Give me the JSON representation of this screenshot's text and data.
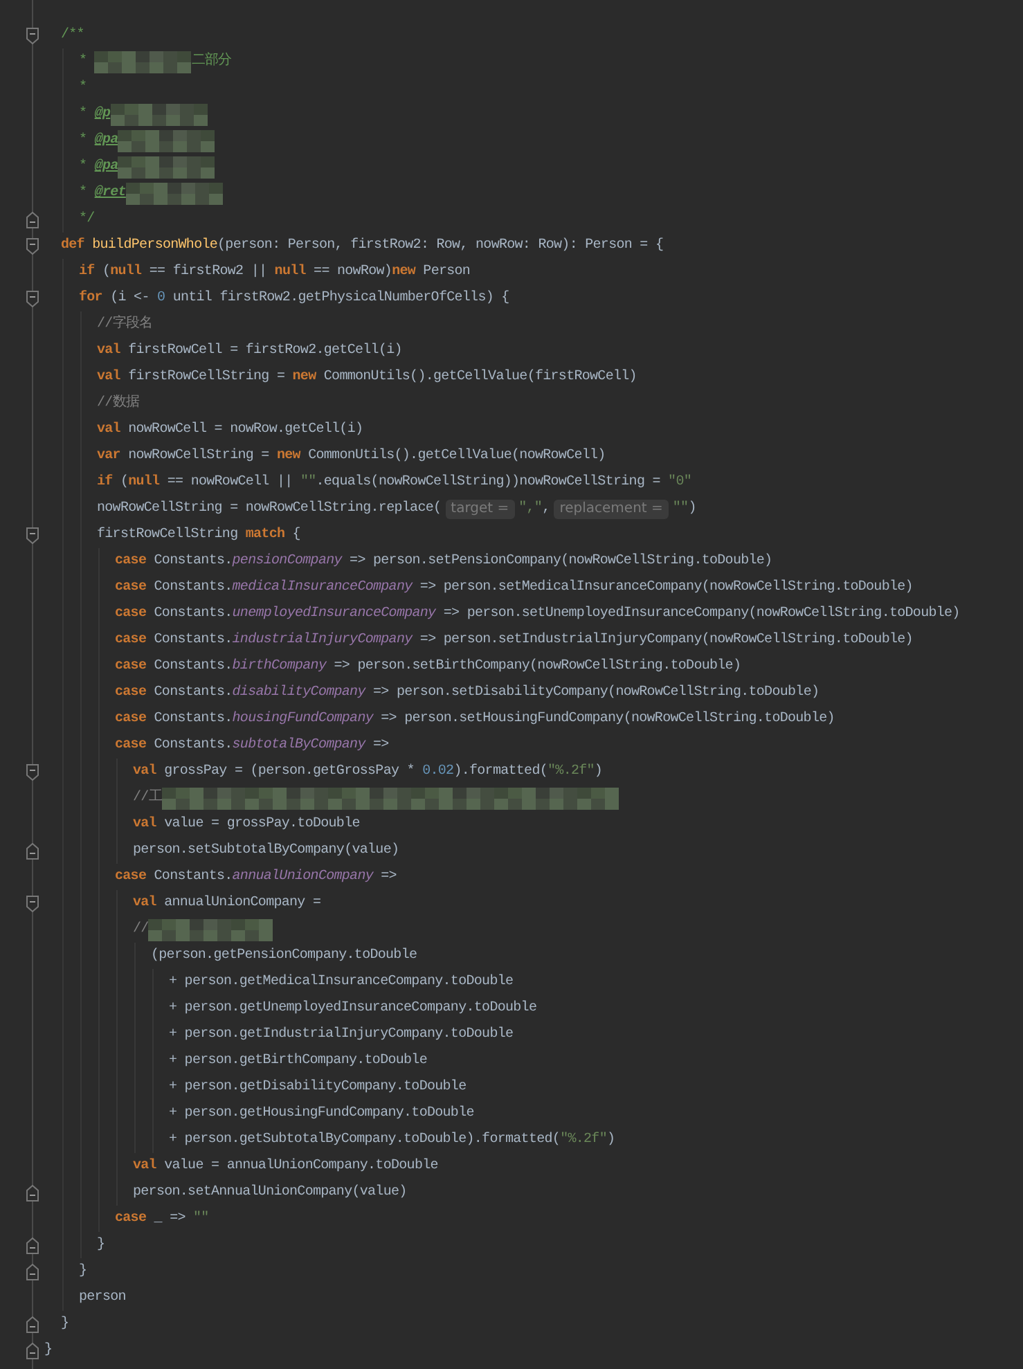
{
  "lines": [
    {
      "kind": "foldstart",
      "tokens": [
        {
          "kind": "doc",
          "text": "/**"
        }
      ],
      "children": [
        {
          "tokens": [
            {
              "kind": "doc",
              "text": "* "
            },
            {
              "kind": "redacted"
            },
            {
              "kind": "doc",
              "text": "二部分"
            }
          ]
        },
        {
          "tokens": [
            {
              "kind": "doc",
              "text": "*"
            }
          ]
        },
        {
          "tokens": [
            {
              "kind": "doc",
              "text": "* "
            },
            {
              "kind": "doctag",
              "text": "@p"
            },
            {
              "kind": "redacted"
            }
          ]
        },
        {
          "tokens": [
            {
              "kind": "doc",
              "text": "* "
            },
            {
              "kind": "doctag",
              "text": "@pa"
            },
            {
              "kind": "redacted"
            }
          ]
        },
        {
          "tokens": [
            {
              "kind": "doc",
              "text": "* "
            },
            {
              "kind": "doctag",
              "text": "@pa"
            },
            {
              "kind": "redacted"
            }
          ]
        },
        {
          "tokens": [
            {
              "kind": "doc",
              "text": "* "
            },
            {
              "kind": "doctag",
              "text": "@ret"
            },
            {
              "kind": "redacted"
            }
          ]
        },
        {
          "kind": "foldend",
          "tokens": [
            {
              "kind": "doc",
              "text": "*/"
            }
          ]
        }
      ]
    },
    {
      "kind": "foldstart",
      "tokens": [
        {
          "kind": "keyword",
          "text": "def "
        },
        {
          "kind": "function",
          "text": "buildPersonWhole"
        },
        {
          "kind": "plain",
          "text": "(person: Person, firstRow2: Row, nowRow: Row): Person = {"
        }
      ],
      "children": [
        {
          "tokens": [
            {
              "kind": "keyword",
              "text": "if "
            },
            {
              "kind": "plain",
              "text": "("
            },
            {
              "kind": "keyword",
              "text": "null"
            },
            {
              "kind": "plain",
              "text": " == firstRow2 || "
            },
            {
              "kind": "keyword",
              "text": "null"
            },
            {
              "kind": "plain",
              "text": " == nowRow)"
            },
            {
              "kind": "keyword",
              "text": "new"
            },
            {
              "kind": "plain",
              "text": " Person"
            }
          ]
        },
        {
          "kind": "foldstart",
          "tokens": [
            {
              "kind": "keyword",
              "text": "for "
            },
            {
              "kind": "plain",
              "text": "(i <- "
            },
            {
              "kind": "number",
              "text": "0"
            },
            {
              "kind": "plain",
              "text": " until firstRow2.getPhysicalNumberOfCells) {"
            }
          ],
          "children": [
            {
              "tokens": [
                {
                  "kind": "comment",
                  "text": "//字段名"
                }
              ]
            },
            {
              "tokens": [
                {
                  "kind": "keyword",
                  "text": "val "
                },
                {
                  "kind": "plain",
                  "text": "firstRowCell = firstRow2.getCell(i)"
                }
              ]
            },
            {
              "tokens": [
                {
                  "kind": "keyword",
                  "text": "val "
                },
                {
                  "kind": "plain",
                  "text": "firstRowCellString = "
                },
                {
                  "kind": "keyword",
                  "text": "new "
                },
                {
                  "kind": "plain",
                  "text": "CommonUtils().getCellValue(firstRowCell)"
                }
              ]
            },
            {
              "tokens": [
                {
                  "kind": "comment",
                  "text": "//数据"
                }
              ]
            },
            {
              "tokens": [
                {
                  "kind": "keyword",
                  "text": "val "
                },
                {
                  "kind": "plain",
                  "text": "nowRowCell = nowRow.getCell(i)"
                }
              ]
            },
            {
              "tokens": [
                {
                  "kind": "keyword",
                  "text": "var "
                },
                {
                  "kind": "plain",
                  "text": "nowRowCellString = "
                },
                {
                  "kind": "keyword",
                  "text": "new "
                },
                {
                  "kind": "plain",
                  "text": "CommonUtils().getCellValue(nowRowCell)"
                }
              ]
            },
            {
              "tokens": [
                {
                  "kind": "keyword",
                  "text": "if "
                },
                {
                  "kind": "plain",
                  "text": "("
                },
                {
                  "kind": "keyword",
                  "text": "null"
                },
                {
                  "kind": "plain",
                  "text": " == nowRowCell || "
                },
                {
                  "kind": "string",
                  "text": "\"\""
                },
                {
                  "kind": "plain",
                  "text": ".equals(nowRowCellString))nowRowCellString = "
                },
                {
                  "kind": "string",
                  "text": "\"0\""
                }
              ]
            },
            {
              "tokens": [
                {
                  "kind": "plain",
                  "text": "nowRowCellString = nowRowCellString.replace("
                },
                {
                  "kind": "hint",
                  "text": "target ="
                },
                {
                  "kind": "string",
                  "text": "\",\""
                },
                {
                  "kind": "plain",
                  "text": ","
                },
                {
                  "kind": "hint",
                  "text": "replacement ="
                },
                {
                  "kind": "string",
                  "text": "\"\""
                },
                {
                  "kind": "plain",
                  "text": ")"
                }
              ]
            },
            {
              "kind": "foldstart",
              "tokens": [
                {
                  "kind": "plain",
                  "text": "firstRowCellString "
                },
                {
                  "kind": "keyword",
                  "text": "match"
                },
                {
                  "kind": "plain",
                  "text": " {"
                }
              ],
              "children": [
                {
                  "tokens": [
                    {
                      "kind": "keyword",
                      "text": "case "
                    },
                    {
                      "kind": "plain",
                      "text": "Constants."
                    },
                    {
                      "kind": "constant",
                      "text": "pensionCompany"
                    },
                    {
                      "kind": "plain",
                      "text": " => person.setPensionCompany(nowRowCellString.toDouble)"
                    }
                  ]
                },
                {
                  "tokens": [
                    {
                      "kind": "keyword",
                      "text": "case "
                    },
                    {
                      "kind": "plain",
                      "text": "Constants."
                    },
                    {
                      "kind": "constant",
                      "text": "medicalInsuranceCompany"
                    },
                    {
                      "kind": "plain",
                      "text": " => person.setMedicalInsuranceCompany(nowRowCellString.toDouble)"
                    }
                  ]
                },
                {
                  "tokens": [
                    {
                      "kind": "keyword",
                      "text": "case "
                    },
                    {
                      "kind": "plain",
                      "text": "Constants."
                    },
                    {
                      "kind": "constant",
                      "text": "unemployedInsuranceCompany"
                    },
                    {
                      "kind": "plain",
                      "text": " => person.setUnemployedInsuranceCompany(nowRowCellString.toDouble)"
                    }
                  ]
                },
                {
                  "tokens": [
                    {
                      "kind": "keyword",
                      "text": "case "
                    },
                    {
                      "kind": "plain",
                      "text": "Constants."
                    },
                    {
                      "kind": "constant",
                      "text": "industrialInjuryCompany"
                    },
                    {
                      "kind": "plain",
                      "text": " => person.setIndustrialInjuryCompany(nowRowCellString.toDouble)"
                    }
                  ]
                },
                {
                  "tokens": [
                    {
                      "kind": "keyword",
                      "text": "case "
                    },
                    {
                      "kind": "plain",
                      "text": "Constants."
                    },
                    {
                      "kind": "constant",
                      "text": "birthCompany"
                    },
                    {
                      "kind": "plain",
                      "text": " => person.setBirthCompany(nowRowCellString.toDouble)"
                    }
                  ]
                },
                {
                  "tokens": [
                    {
                      "kind": "keyword",
                      "text": "case "
                    },
                    {
                      "kind": "plain",
                      "text": "Constants."
                    },
                    {
                      "kind": "constant",
                      "text": "disabilityCompany"
                    },
                    {
                      "kind": "plain",
                      "text": " => person.setDisabilityCompany(nowRowCellString.toDouble)"
                    }
                  ]
                },
                {
                  "tokens": [
                    {
                      "kind": "keyword",
                      "text": "case "
                    },
                    {
                      "kind": "plain",
                      "text": "Constants."
                    },
                    {
                      "kind": "constant",
                      "text": "housingFundCompany"
                    },
                    {
                      "kind": "plain",
                      "text": " => person.setHousingFundCompany(nowRowCellString.toDouble)"
                    }
                  ]
                },
                {
                  "tokens": [
                    {
                      "kind": "keyword",
                      "text": "case "
                    },
                    {
                      "kind": "plain",
                      "text": "Constants."
                    },
                    {
                      "kind": "constant",
                      "text": "subtotalByCompany"
                    },
                    {
                      "kind": "plain",
                      "text": " =>"
                    }
                  ],
                  "children": [
                    {
                      "kind": "foldstart",
                      "tokens": [
                        {
                          "kind": "keyword",
                          "text": "val "
                        },
                        {
                          "kind": "plain",
                          "text": "grossPay = (person.getGrossPay * "
                        },
                        {
                          "kind": "number",
                          "text": "0.02"
                        },
                        {
                          "kind": "plain",
                          "text": ").formatted("
                        },
                        {
                          "kind": "string",
                          "text": "\"%.2f\""
                        },
                        {
                          "kind": "plain",
                          "text": ")"
                        }
                      ]
                    },
                    {
                      "tokens": [
                        {
                          "kind": "comment",
                          "text": "//工"
                        },
                        {
                          "kind": "redactedlong"
                        }
                      ]
                    },
                    {
                      "tokens": [
                        {
                          "kind": "keyword",
                          "text": "val "
                        },
                        {
                          "kind": "plain",
                          "text": "value = grossPay.toDouble"
                        }
                      ]
                    },
                    {
                      "kind": "foldend",
                      "tokens": [
                        {
                          "kind": "plain",
                          "text": "person.setSubtotalByCompany(value)"
                        }
                      ]
                    }
                  ]
                },
                {
                  "tokens": [
                    {
                      "kind": "keyword",
                      "text": "case "
                    },
                    {
                      "kind": "plain",
                      "text": "Constants."
                    },
                    {
                      "kind": "constant",
                      "text": "annualUnionCompany"
                    },
                    {
                      "kind": "plain",
                      "text": " =>"
                    }
                  ],
                  "children": [
                    {
                      "kind": "foldstart",
                      "tokens": [
                        {
                          "kind": "keyword",
                          "text": "val "
                        },
                        {
                          "kind": "plain",
                          "text": "annualUnionCompany ="
                        }
                      ]
                    },
                    {
                      "tokens": [
                        {
                          "kind": "comment",
                          "text": "//"
                        },
                        {
                          "kind": "redactedmedium"
                        }
                      ],
                      "children": [
                        {
                          "tokens": [
                            {
                              "kind": "plain",
                              "text": "(person.getPensionCompany.toDouble"
                            }
                          ],
                          "children": [
                            {
                              "tokens": [
                                {
                                  "kind": "plain",
                                  "text": "+ person.getMedicalInsuranceCompany.toDouble"
                                }
                              ]
                            },
                            {
                              "tokens": [
                                {
                                  "kind": "plain",
                                  "text": "+ person.getUnemployedInsuranceCompany.toDouble"
                                }
                              ]
                            },
                            {
                              "tokens": [
                                {
                                  "kind": "plain",
                                  "text": "+ person.getIndustrialInjuryCompany.toDouble"
                                }
                              ]
                            },
                            {
                              "tokens": [
                                {
                                  "kind": "plain",
                                  "text": "+ person.getBirthCompany.toDouble"
                                }
                              ]
                            },
                            {
                              "tokens": [
                                {
                                  "kind": "plain",
                                  "text": "+ person.getDisabilityCompany.toDouble"
                                }
                              ]
                            },
                            {
                              "tokens": [
                                {
                                  "kind": "plain",
                                  "text": "+ person.getHousingFundCompany.toDouble"
                                }
                              ]
                            },
                            {
                              "tokens": [
                                {
                                  "kind": "plain",
                                  "text": "+ person.getSubtotalByCompany.toDouble).formatted("
                                },
                                {
                                  "kind": "string",
                                  "text": "\"%.2f\""
                                },
                                {
                                  "kind": "plain",
                                  "text": ")"
                                }
                              ]
                            }
                          ]
                        }
                      ]
                    },
                    {
                      "tokens": [
                        {
                          "kind": "keyword",
                          "text": "val "
                        },
                        {
                          "kind": "plain",
                          "text": "value = annualUnionCompany.toDouble"
                        }
                      ]
                    },
                    {
                      "kind": "foldend",
                      "tokens": [
                        {
                          "kind": "plain",
                          "text": "person.setAnnualUnionCompany(value)"
                        }
                      ]
                    }
                  ]
                },
                {
                  "tokens": [
                    {
                      "kind": "keyword",
                      "text": "case "
                    },
                    {
                      "kind": "plain",
                      "text": "_ => "
                    },
                    {
                      "kind": "string",
                      "text": "\"\""
                    }
                  ]
                }
              ]
            },
            {
              "kind": "foldend",
              "tokens": [
                {
                  "kind": "plain",
                  "text": "}"
                }
              ]
            }
          ]
        },
        {
          "kind": "foldend",
          "tokens": [
            {
              "kind": "plain",
              "text": "}"
            }
          ]
        },
        {
          "tokens": [
            {
              "kind": "plain",
              "text": "person"
            }
          ]
        }
      ]
    },
    {
      "kind": "foldend",
      "tokens": [
        {
          "kind": "plain",
          "text": "}"
        }
      ]
    }
  ],
  "outer_close": {
    "kind": "foldend",
    "tokens": [
      {
        "kind": "plain",
        "text": "}"
      }
    ]
  }
}
